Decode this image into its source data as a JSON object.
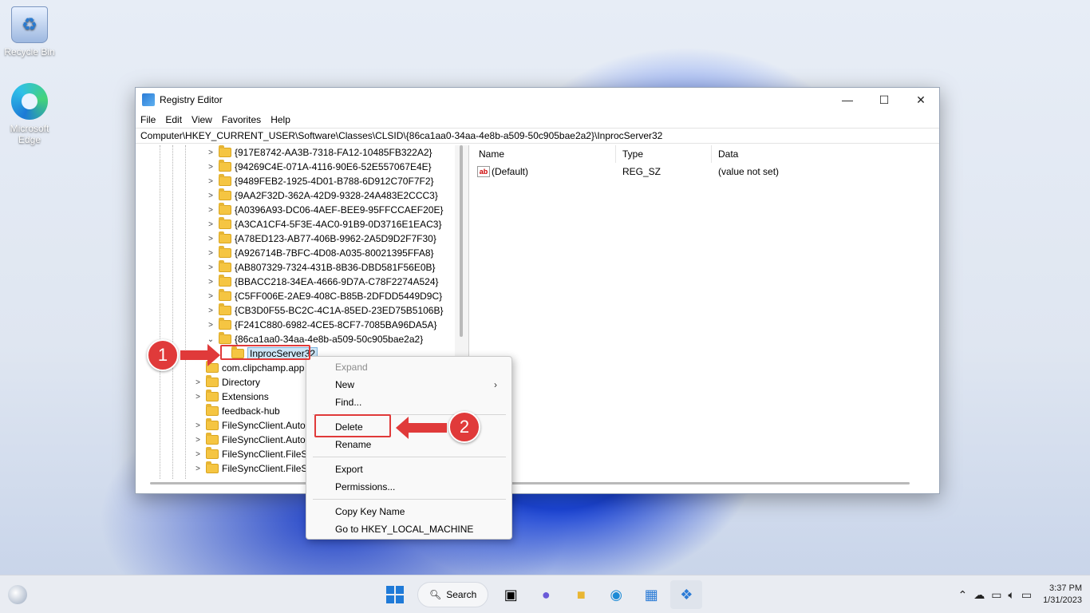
{
  "desktop": {
    "icons": [
      {
        "label": "Recycle Bin",
        "icon": "recycle-bin-icon"
      },
      {
        "label": "Microsoft Edge",
        "icon": "edge-icon"
      }
    ]
  },
  "window": {
    "title": "Registry Editor",
    "controls": {
      "minimize": "—",
      "maximize": "☐",
      "close": "✕"
    },
    "menu": [
      "File",
      "Edit",
      "View",
      "Favorites",
      "Help"
    ],
    "address": "Computer\\HKEY_CURRENT_USER\\Software\\Classes\\CLSID\\{86ca1aa0-34aa-4e8b-a509-50c905bae2a2}\\InprocServer32"
  },
  "tree": {
    "rows": [
      {
        "label": "{917E8742-AA3B-7318-FA12-10485FB322A2}",
        "chevron": ">",
        "indent": 2
      },
      {
        "label": "{94269C4E-071A-4116-90E6-52E557067E4E}",
        "chevron": ">",
        "indent": 2
      },
      {
        "label": "{9489FEB2-1925-4D01-B788-6D912C70F7F2}",
        "chevron": ">",
        "indent": 2
      },
      {
        "label": "{9AA2F32D-362A-42D9-9328-24A483E2CCC3}",
        "chevron": ">",
        "indent": 2
      },
      {
        "label": "{A0396A93-DC06-4AEF-BEE9-95FFCCAEF20E}",
        "chevron": ">",
        "indent": 2
      },
      {
        "label": "{A3CA1CF4-5F3E-4AC0-91B9-0D3716E1EAC3}",
        "chevron": ">",
        "indent": 2
      },
      {
        "label": "{A78ED123-AB77-406B-9962-2A5D9D2F7F30}",
        "chevron": ">",
        "indent": 2
      },
      {
        "label": "{A926714B-7BFC-4D08-A035-80021395FFA8}",
        "chevron": ">",
        "indent": 2
      },
      {
        "label": "{AB807329-7324-431B-8B36-DBD581F56E0B}",
        "chevron": ">",
        "indent": 2
      },
      {
        "label": "{BBACC218-34EA-4666-9D7A-C78F2274A524}",
        "chevron": ">",
        "indent": 2
      },
      {
        "label": "{C5FF006E-2AE9-408C-B85B-2DFDD5449D9C}",
        "chevron": ">",
        "indent": 2
      },
      {
        "label": "{CB3D0F55-BC2C-4C1A-85ED-23ED75B5106B}",
        "chevron": ">",
        "indent": 2
      },
      {
        "label": "{F241C880-6982-4CE5-8CF7-7085BA96DA5A}",
        "chevron": ">",
        "indent": 2
      },
      {
        "label": "{86ca1aa0-34aa-4e8b-a509-50c905bae2a2}",
        "chevron": "⌄",
        "indent": 2
      },
      {
        "label": "InprocServer32",
        "chevron": "",
        "indent": 3,
        "selected": true
      },
      {
        "label": "com.clipchamp.app",
        "chevron": "",
        "indent": 1
      },
      {
        "label": "Directory",
        "chevron": ">",
        "indent": 1
      },
      {
        "label": "Extensions",
        "chevron": ">",
        "indent": 1
      },
      {
        "label": "feedback-hub",
        "chevron": "",
        "indent": 1
      },
      {
        "label": "FileSyncClient.AutoP",
        "chevron": ">",
        "indent": 1
      },
      {
        "label": "FileSyncClient.AutoP",
        "chevron": ">",
        "indent": 1
      },
      {
        "label": "FileSyncClient.FileSy",
        "chevron": ">",
        "indent": 1
      },
      {
        "label": "FileSyncClient.FileSy",
        "chevron": ">",
        "indent": 1
      }
    ]
  },
  "values": {
    "columns": [
      "Name",
      "Type",
      "Data"
    ],
    "rows": [
      {
        "name": "(Default)",
        "type": "REG_SZ",
        "data": "(value not set)",
        "icon": "ab-string-icon"
      }
    ]
  },
  "context_menu": {
    "groups": [
      [
        {
          "label": "Expand",
          "disabled": true
        },
        {
          "label": "New",
          "submenu": true
        },
        {
          "label": "Find..."
        }
      ],
      [
        {
          "label": "Delete",
          "highlight": true
        },
        {
          "label": "Rename"
        }
      ],
      [
        {
          "label": "Export"
        },
        {
          "label": "Permissions..."
        }
      ],
      [
        {
          "label": "Copy Key Name"
        },
        {
          "label": "Go to HKEY_LOCAL_MACHINE"
        }
      ]
    ]
  },
  "annotations": {
    "step1": "1",
    "step2": "2",
    "color": "#e03a3a"
  },
  "taskbar": {
    "search_label": "Search",
    "apps": [
      "start-icon",
      "search-icon",
      "task-view-icon",
      "chat-icon",
      "file-explorer-icon",
      "edge-icon",
      "store-icon",
      "registry-editor-icon"
    ],
    "tray_icons": [
      "chevron-up-icon",
      "cloud-icon",
      "display-icon",
      "speaker-icon",
      "battery-icon"
    ],
    "time": "3:37 PM",
    "date": "1/31/2023"
  }
}
